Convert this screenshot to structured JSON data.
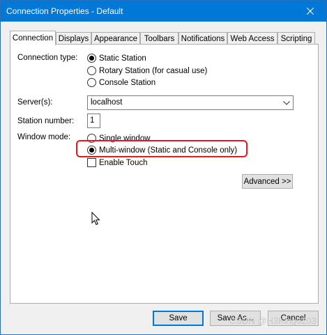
{
  "window": {
    "title": "Connection Properties - Default"
  },
  "tabs": [
    {
      "label": "Connection"
    },
    {
      "label": "Displays"
    },
    {
      "label": "Appearance"
    },
    {
      "label": "Toolbars"
    },
    {
      "label": "Notifications"
    },
    {
      "label": "Web Access"
    },
    {
      "label": "Scripting"
    }
  ],
  "connection": {
    "type_label": "Connection type:",
    "type_options": [
      {
        "label": "Static Station",
        "selected": true
      },
      {
        "label": "Rotary Station (for casual use)",
        "selected": false
      },
      {
        "label": "Console Station",
        "selected": false
      }
    ],
    "servers_label": "Server(s):",
    "servers_value": "localhost",
    "station_number_label": "Station number:",
    "station_number_value": "1",
    "window_mode_label": "Window mode:",
    "window_mode_options": [
      {
        "label": "Single window",
        "selected": false
      },
      {
        "label": "Multi-window (Static and Console only)",
        "selected": true
      }
    ],
    "enable_touch_label": "Enable Touch",
    "enable_touch_checked": false,
    "advanced_label": "Advanced >>"
  },
  "footer": {
    "save_label": "Save",
    "save_as_label": "Save As...",
    "cancel_label": "Cancel"
  },
  "watermark": "CSDN @H3King6203",
  "colors": {
    "titlebar": "#0078d7",
    "highlight": "#e51919"
  }
}
